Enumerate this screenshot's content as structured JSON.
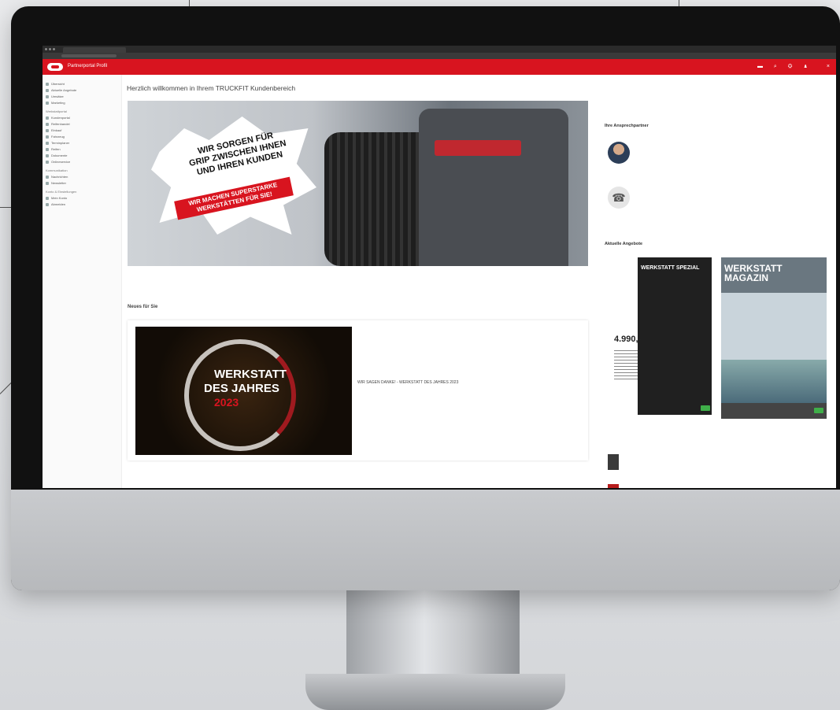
{
  "app": {
    "name": "Partnerportal Profil",
    "header_icons": "▬ ⌕ ⚙ ♟",
    "close": "×"
  },
  "sidebar": {
    "items_top": [
      "Übersicht",
      "Aktuelle Angebote",
      "Umsätze",
      "Marketing"
    ],
    "section1": "Werkstattportal",
    "items1": [
      "Kundenportal",
      "Reifenhandel",
      "Einkauf",
      "Fahrzeug",
      "Terminplaner",
      "Reifen",
      "Dokumente",
      "Onlineservice"
    ],
    "section2": "Kommunikation",
    "items2": [
      "Nachrichten",
      "Newsletter"
    ],
    "section3": "Konto & Einstellungen",
    "items3": [
      "Mein Konto",
      "Abmelden"
    ]
  },
  "main": {
    "title": "Herzlich willkommen in Ihrem TRUCKFIT Kundenbereich",
    "hero": {
      "burst_line1": "WIR SORGEN FÜR",
      "burst_line2": "GRIP ZWISCHEN IHNEN",
      "burst_line3": "UND IHREN KUNDEN",
      "burst_red": "WIR MACHEN SUPERSTARKE WERKSTÄTTEN FÜR SIE!"
    },
    "news_heading": "Neues für Sie",
    "news": {
      "award_line1": "WERKSTATT",
      "award_line2": "DES JAHRES",
      "award_year": "2023",
      "headline": "WIR SAGEN DANKE! - WERKSTATT DES JAHRES 2023"
    }
  },
  "right": {
    "contact_heading": "Ihre Ansprechpartner",
    "online_heading": "Aktuelle Angebote",
    "promo": {
      "head": "WERKSTATT SPEZIAL",
      "price": "4.990,-"
    },
    "magazine": {
      "title1": "WERKSTATT",
      "title2": "MAGAZIN"
    }
  },
  "colors": {
    "brand_red": "#d8141f",
    "accent_green": "#3fae49"
  }
}
